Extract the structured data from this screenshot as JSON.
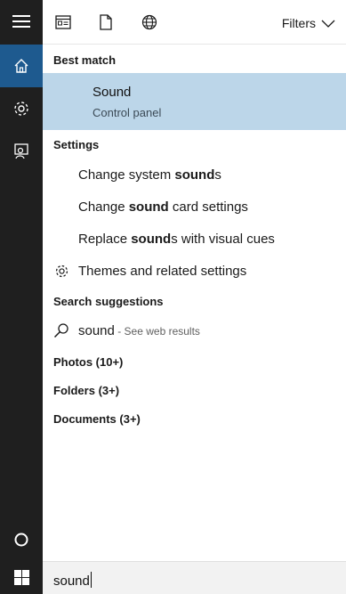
{
  "toolbar": {
    "filters_label": "Filters",
    "icons": [
      "apps-icon",
      "document-icon",
      "web-icon"
    ]
  },
  "sidebar": {
    "items": [
      {
        "icon": "hamburger-menu-icon"
      },
      {
        "icon": "home-icon",
        "active": true
      },
      {
        "icon": "gear-icon"
      },
      {
        "icon": "feedback-icon"
      },
      {
        "icon": "cortana-circle-icon"
      }
    ]
  },
  "results": {
    "best_match_header": "Best match",
    "best_match": {
      "title": "Sound",
      "subtitle": "Control panel"
    },
    "settings_header": "Settings",
    "settings": [
      {
        "pre": "Change system ",
        "bold": "sound",
        "post": "s"
      },
      {
        "pre": "Change ",
        "bold": "sound",
        "post": " card settings"
      },
      {
        "pre": "Replace ",
        "bold": "sound",
        "post": "s with visual cues"
      },
      {
        "pre": "Themes and related settings",
        "bold": "",
        "post": ""
      }
    ],
    "suggestions_header": "Search suggestions",
    "suggestion": {
      "query": "sound",
      "hint": " - See web results"
    },
    "categories": [
      {
        "label": "Photos (10+)"
      },
      {
        "label": "Folders (3+)"
      },
      {
        "label": "Documents (3+)"
      }
    ]
  },
  "search": {
    "value": "sound"
  },
  "colors": {
    "rail": "#1f1f1f",
    "active_rail": "#1e5a8f",
    "best_match_bg": "#bcd6e9"
  }
}
